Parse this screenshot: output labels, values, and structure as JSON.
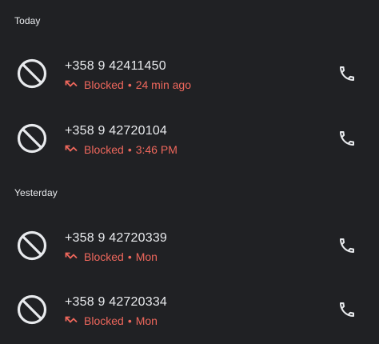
{
  "colors": {
    "background": "#202124",
    "primary_text": "#e8eaed",
    "blocked_text": "#ee675c",
    "icon": "#e8eaed"
  },
  "sections": [
    {
      "header": "Today",
      "calls": [
        {
          "number": "+358 9 42411450",
          "status": "Blocked",
          "separator": "•",
          "time": "24 min ago",
          "left_icon": "block-icon",
          "right_icon": "phone-icon"
        },
        {
          "number": "+358 9 42720104",
          "status": "Blocked",
          "separator": "•",
          "time": "3:46 PM",
          "left_icon": "block-icon",
          "right_icon": "phone-icon"
        }
      ]
    },
    {
      "header": "Yesterday",
      "calls": [
        {
          "number": "+358 9 42720339",
          "status": "Blocked",
          "separator": "•",
          "time": "Mon",
          "left_icon": "block-icon",
          "right_icon": "phone-icon"
        },
        {
          "number": "+358 9 42720334",
          "status": "Blocked",
          "separator": "•",
          "time": "Mon",
          "left_icon": "block-icon",
          "right_icon": "phone-icon"
        }
      ]
    }
  ]
}
